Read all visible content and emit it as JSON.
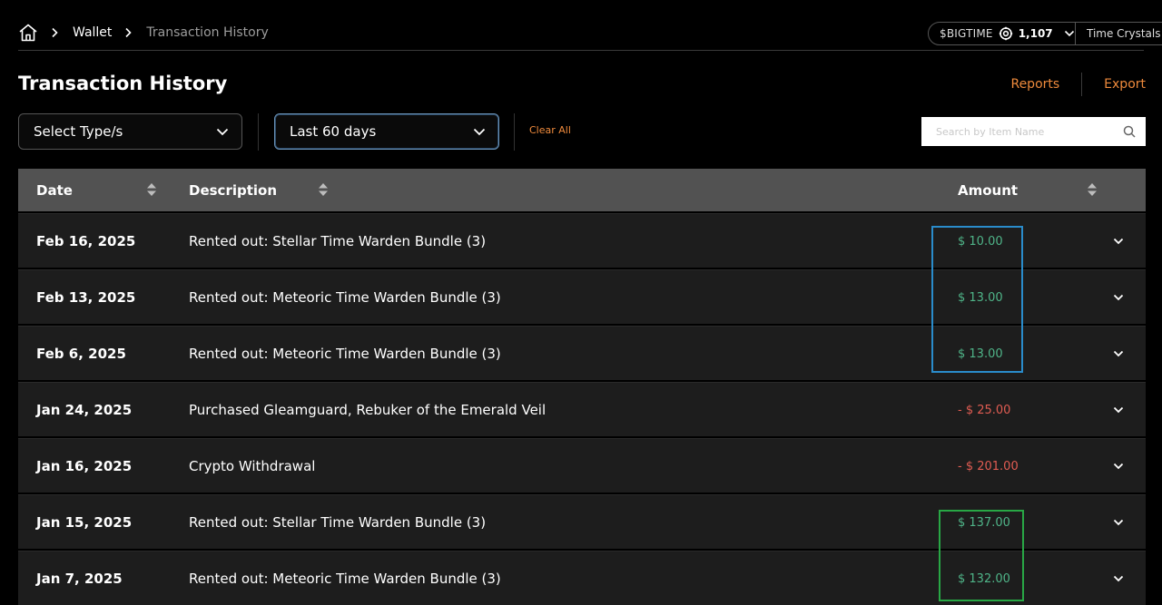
{
  "breadcrumb": {
    "home_icon": "home-icon",
    "wallet": "Wallet",
    "current": "Transaction History"
  },
  "wallet_pill": {
    "currency_label": "$BIGTIME",
    "balance": "1,107",
    "secondary_label": "Time Crystals"
  },
  "header": {
    "title": "Transaction History",
    "reports": "Reports",
    "export": "Export"
  },
  "filters": {
    "type_select": "Select Type/s",
    "range_select": "Last 60 days",
    "clear_all": "Clear All",
    "search_placeholder": "Search by Item Name"
  },
  "table": {
    "columns": {
      "date": "Date",
      "description": "Description",
      "amount": "Amount"
    },
    "rows": [
      {
        "date": "Feb 16, 2025",
        "description": "Rented out: Stellar Time Warden Bundle (3)",
        "amount": "$ 10.00",
        "sign": "positive"
      },
      {
        "date": "Feb 13, 2025",
        "description": "Rented out: Meteoric Time Warden Bundle (3)",
        "amount": "$ 13.00",
        "sign": "positive"
      },
      {
        "date": "Feb 6, 2025",
        "description": "Rented out: Meteoric Time Warden Bundle (3)",
        "amount": "$ 13.00",
        "sign": "positive"
      },
      {
        "date": "Jan 24, 2025",
        "description": "Purchased Gleamguard, Rebuker of the Emerald Veil",
        "amount": "- $ 25.00",
        "sign": "negative"
      },
      {
        "date": "Jan 16, 2025",
        "description": "Crypto Withdrawal",
        "amount": "- $ 201.00",
        "sign": "negative"
      },
      {
        "date": "Jan 15, 2025",
        "description": "Rented out: Stellar Time Warden Bundle (3)",
        "amount": "$ 137.00",
        "sign": "positive"
      },
      {
        "date": "Jan 7, 2025",
        "description": "Rented out: Meteoric Time Warden Bundle (3)",
        "amount": "$ 132.00",
        "sign": "positive"
      }
    ]
  },
  "colors": {
    "accent": "#ee8a3c",
    "positive": "#4fb488",
    "negative": "#e05c52",
    "highlight_blue": "#2a8ccb",
    "highlight_green": "#28a745"
  }
}
